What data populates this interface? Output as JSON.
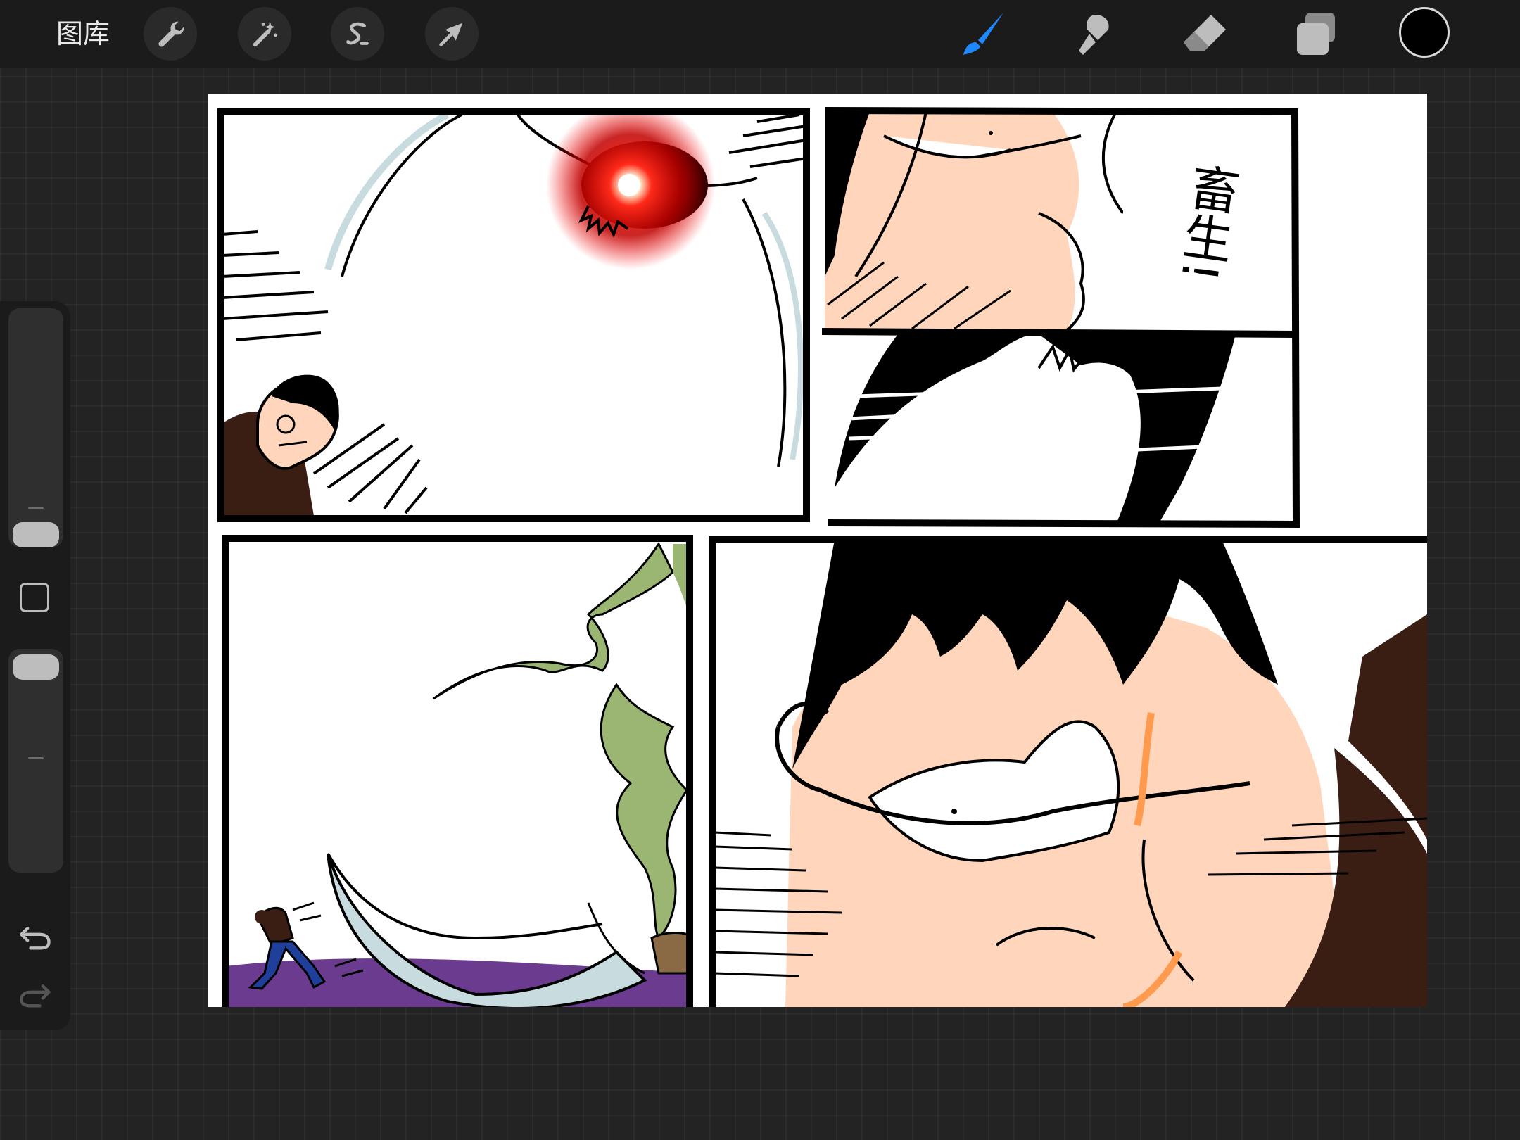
{
  "topbar": {
    "gallery_label": "图库",
    "left_tools": [
      {
        "name": "actions",
        "icon": "wrench-icon"
      },
      {
        "name": "adjustments",
        "icon": "magic-wand-icon"
      },
      {
        "name": "selection",
        "icon": "selection-s-icon"
      },
      {
        "name": "transform",
        "icon": "arrow-cursor-icon"
      }
    ],
    "right_tools": [
      {
        "name": "brush",
        "icon": "brush-icon",
        "active": true
      },
      {
        "name": "smudge",
        "icon": "smudge-icon",
        "active": false
      },
      {
        "name": "eraser",
        "icon": "eraser-icon",
        "active": false
      },
      {
        "name": "layers",
        "icon": "layers-icon",
        "active": false
      }
    ],
    "current_color": "#000000",
    "active_tool_color": "#1e88ff"
  },
  "sidebar": {
    "size_slider": {
      "icon": "brush-size-slider"
    },
    "modify_button": {
      "icon": "square-modify-icon"
    },
    "opacity_slider": {
      "icon": "opacity-slider"
    },
    "undo": {
      "icon": "undo-icon"
    },
    "redo": {
      "icon": "redo-icon",
      "enabled": false
    }
  },
  "canvas": {
    "panel_text": "畜生!",
    "colors": {
      "skin": "#ffd5bc",
      "hair": "#000000",
      "coat": "#3a1e14",
      "glow_red": "#e01010",
      "smoke_green": "#9bb673",
      "blade": "#c8dce0",
      "ground_purple": "#6a3b8e",
      "pants_blue": "#1f3f9a",
      "orange_accent": "#ff9a4f"
    }
  }
}
